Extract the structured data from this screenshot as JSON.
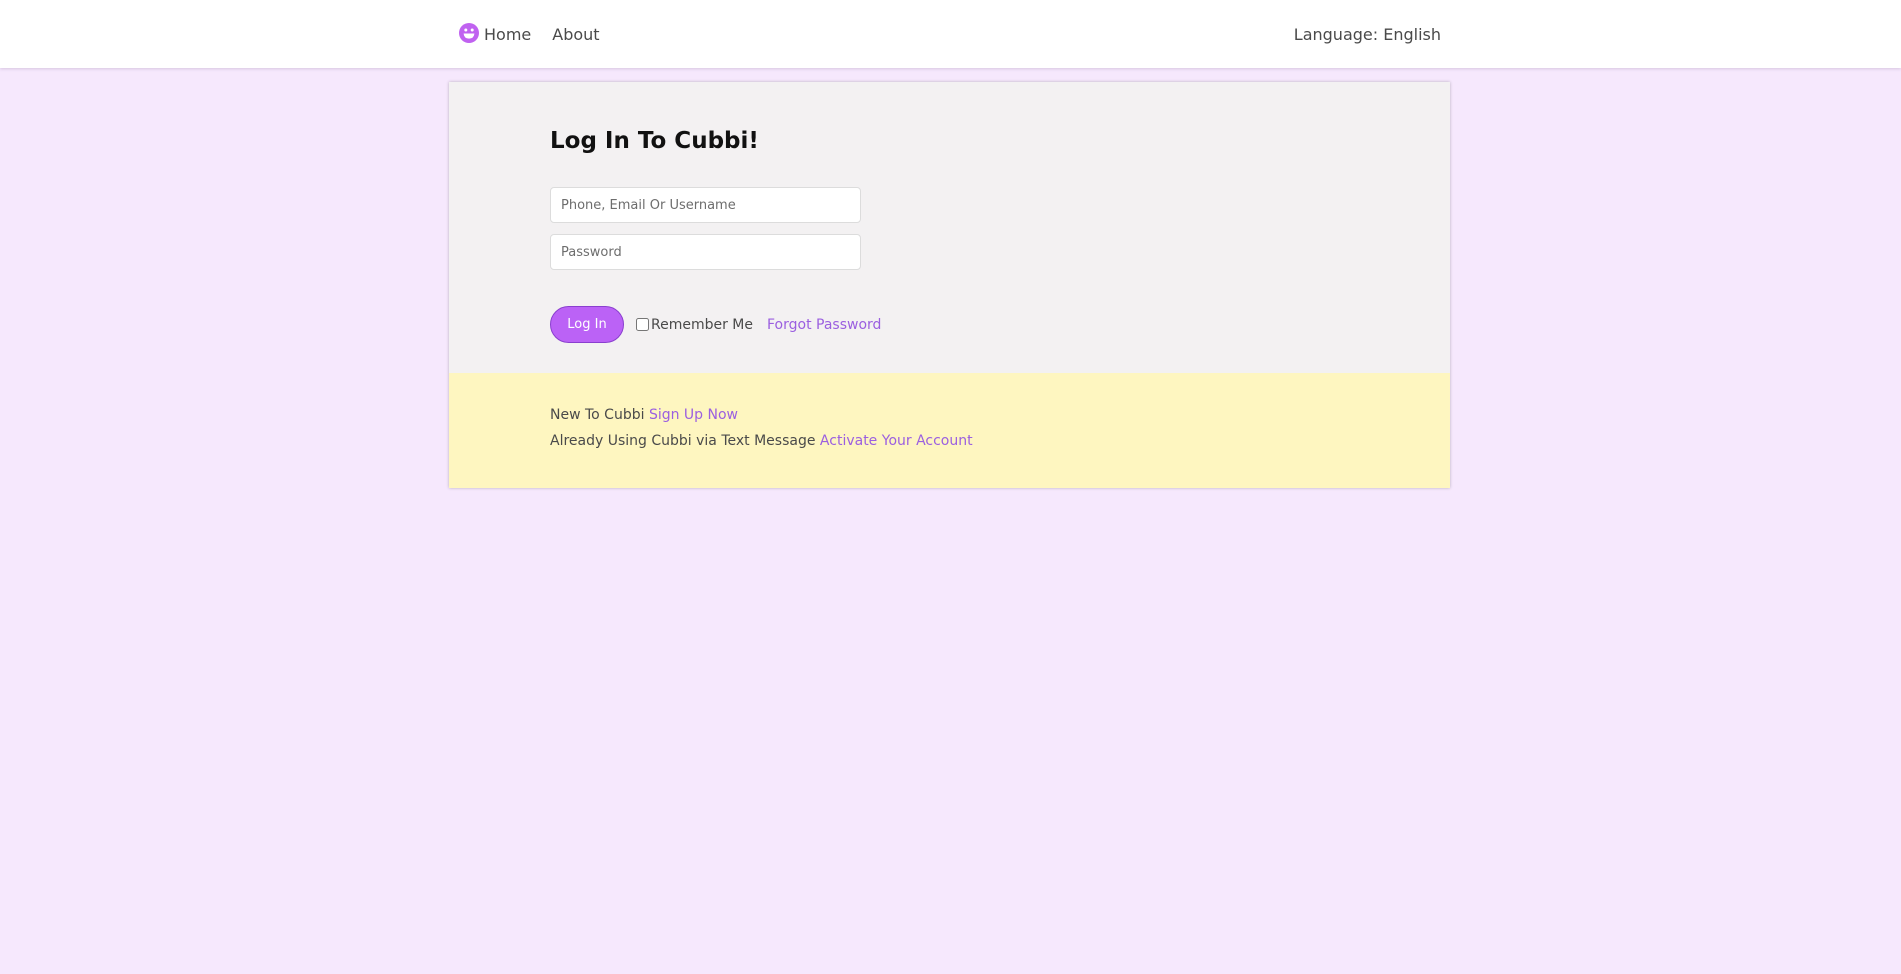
{
  "nav": {
    "logo_icon": "smiley-face-icon",
    "home_label": "Home",
    "about_label": "About",
    "language_label": "Language: English"
  },
  "login": {
    "title": "Log In To Cubbi!",
    "username_placeholder": "Phone, Email Or Username",
    "password_placeholder": "Password",
    "login_button": "Log In",
    "remember_label": "Remember Me",
    "remember_checked": false,
    "forgot_label": "Forgot Password"
  },
  "signup": {
    "new_text": "New To Cubbi",
    "signup_link": "Sign Up Now",
    "activate_text": "Already Using Cubbi via Text Message",
    "activate_link": "Activate Your Account"
  },
  "colors": {
    "page_background": "#f6e8fd",
    "accent": "#bb62f6",
    "link": "#9b5fe0",
    "card_bottom": "#fef6c0"
  }
}
